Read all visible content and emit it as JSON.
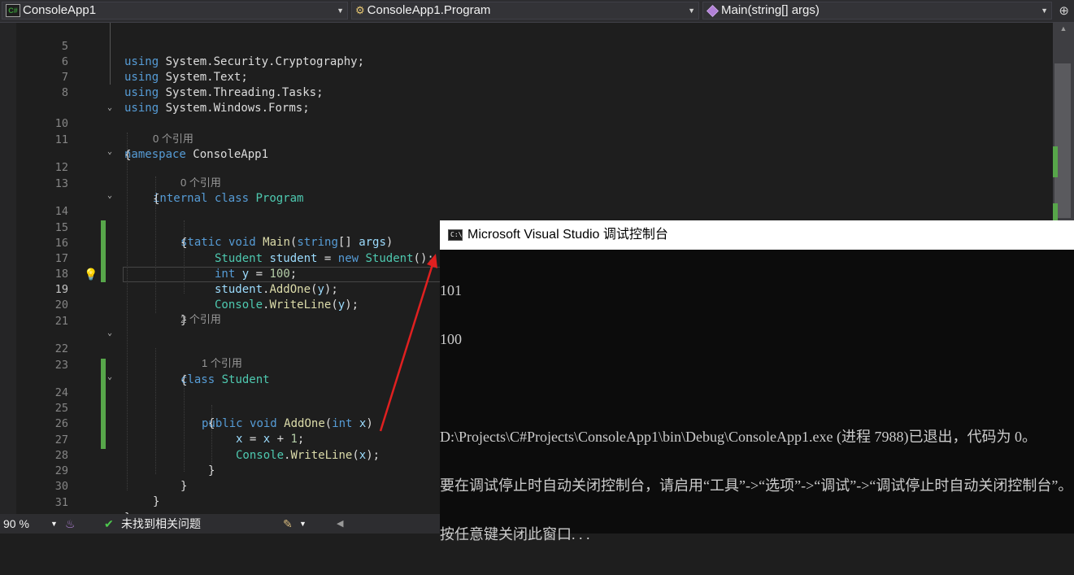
{
  "navbar": {
    "project": "ConsoleApp1",
    "class": "ConsoleApp1.Program",
    "member": "Main(string[] args)",
    "project_icon": "C#"
  },
  "code": {
    "lines": {
      "l5": "5",
      "l6": "6",
      "l7": "7",
      "l8": "8",
      "l10": "10",
      "l11": "11",
      "l12": "12",
      "l13": "13",
      "l14": "14",
      "l15": "15",
      "l16": "16",
      "l17": "17",
      "l18": "18",
      "l19": "19",
      "l20": "20",
      "l21": "21",
      "l22": "22",
      "l23": "23",
      "l24": "24",
      "l25": "25",
      "l26": "26",
      "l27": "27",
      "l28": "28",
      "l29": "29",
      "l30": "30",
      "l31": "31"
    },
    "tokens": {
      "using": "using",
      "sys_security": "System.",
      "security": "Security.",
      "cryptography": "Cryptography",
      "sys_text": "System.",
      "text": "Text",
      "sys_threading": "System.",
      "threading": "Threading.",
      "tasks": "Tasks",
      "sys_windows": "System.",
      "windows": "Windows.",
      "forms": "Forms",
      "semi": ";",
      "namespace": "namespace",
      "ns_name": "ConsoleApp1",
      "open_brace": "{",
      "close_brace": "}",
      "internal": "internal",
      "class": "class",
      "program": "Program",
      "static": "static",
      "void": "void",
      "main": "Main",
      "string": "string",
      "args": "args",
      "student_type": "Student",
      "student_var": "student",
      "new": "new",
      "int": "int",
      "y": "y",
      "hundred": "100",
      "addone": "AddOne",
      "console": "Console",
      "writeline": "WriteLine",
      "public": "public",
      "x": "x",
      "one": "1"
    },
    "refs": {
      "program_refs": "0 个引用",
      "main_refs": "0 个引用",
      "student_refs": "2 个引用",
      "addone_refs": "1 个引用"
    }
  },
  "status": {
    "zoom": "90 %",
    "issues": "未找到相关问题"
  },
  "console": {
    "title": "Microsoft Visual Studio 调试控制台",
    "output": [
      "101",
      "100",
      "",
      "D:\\Projects\\C#Projects\\ConsoleApp1\\bin\\Debug\\ConsoleApp1.exe (进程 7988)已退出，代码为 0。",
      "要在调试停止时自动关闭控制台，请启用“工具”->“选项”->“调试”->“调试停止时自动关闭控制台”。",
      "按任意键关闭此窗口. . ."
    ]
  },
  "colors": {
    "editor_bg": "#1e1e1e",
    "keyword": "#569cd6",
    "type": "#4ec9b0",
    "method": "#dcdcaa",
    "variable": "#9cdcfe",
    "number": "#b5cea8",
    "change_bar": "#57a64a",
    "annotation_arrow": "#e02020"
  }
}
